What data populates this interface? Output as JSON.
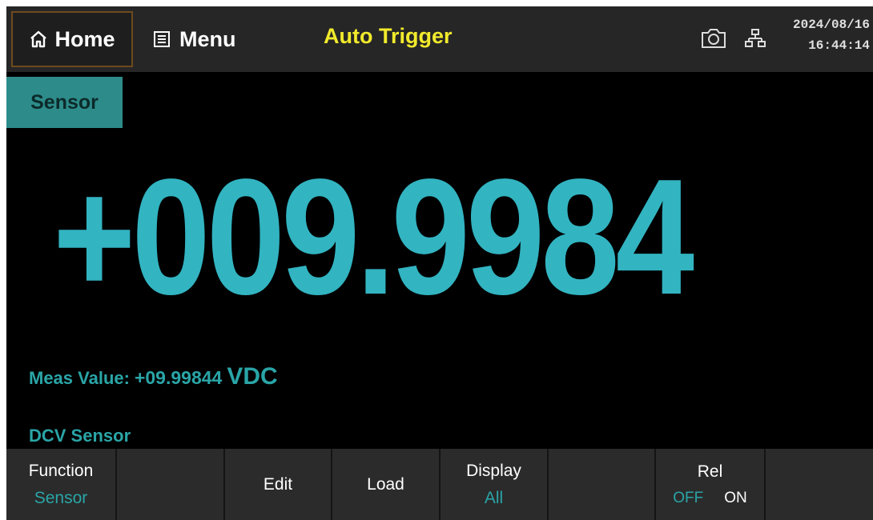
{
  "topbar": {
    "home_label": "Home",
    "menu_label": "Menu",
    "trigger_mode": "Auto Trigger",
    "date": "2024/08/16",
    "time": "16:44:14",
    "icons": [
      "home-icon",
      "menu-icon",
      "camera-icon",
      "network-icon"
    ]
  },
  "mode_tag": "Sensor",
  "reading": {
    "main_value": "+009.9984",
    "meas_label": "Meas Value:",
    "meas_value": "+09.99844",
    "meas_unit": "VDC",
    "function_label": "DCV Sensor"
  },
  "softkeys": [
    {
      "label": "Function",
      "sub": "Sensor"
    },
    {
      "label": ""
    },
    {
      "label": "Edit"
    },
    {
      "label": "Load"
    },
    {
      "label": "Display",
      "sub": "All"
    },
    {
      "label": ""
    },
    {
      "label": "Rel",
      "off": "OFF",
      "on": "ON"
    },
    {
      "label": ""
    }
  ],
  "colors": {
    "accent": "#32b4c1",
    "trigger": "#f1ea2c",
    "tag_bg": "#2d8c8a",
    "bar_bg": "#2b2b2b"
  }
}
